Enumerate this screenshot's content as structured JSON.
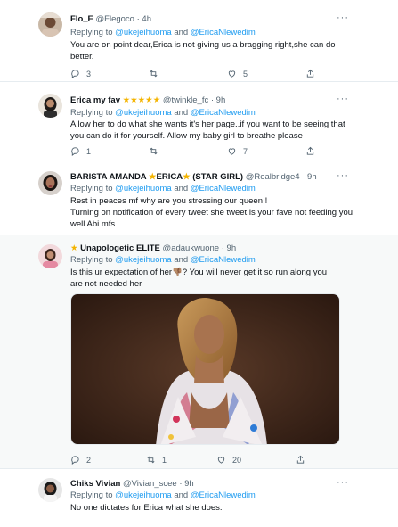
{
  "tweets": [
    {
      "name": "Flo_E",
      "handle": "@Flegoco",
      "time": "4h",
      "reply_prefix": "Replying to",
      "reply_to_1": "@ukejeihuoma",
      "reply_and": "and",
      "reply_to_2": "@EricaNlewedim",
      "text": "You are on point dear,Erica is not giving us a bragging right,she can do better.",
      "replies": "3",
      "likes": "5"
    },
    {
      "name": "Erica my fav",
      "name_stars": "★★★★★",
      "handle": "@twinkle_fc",
      "time": "9h",
      "reply_prefix": "Replying to",
      "reply_to_1": "@ukejeihuoma",
      "reply_and": "and",
      "reply_to_2": "@EricaNlewedim",
      "text": "Allow her to do what she wants it's her page..if you want to be seeing that you can do it for yourself. Allow my baby girl to breathe please",
      "replies": "1",
      "likes": "7"
    },
    {
      "name_part1": "BARISTA AMANDA",
      "star1": "★",
      "name_part2": "ERICA",
      "star2": "★",
      "name_part3": "(STAR GIRL)",
      "handle": "@Realbridge4",
      "time": "9h",
      "reply_prefix": "Replying to",
      "reply_to_1": "@ukejeihuoma",
      "reply_and": "and",
      "reply_to_2": "@EricaNlewedim",
      "text_line1": "Rest in peaces mf why are you stressing our queen !",
      "text_line2": "Turning on notification of every tweet she tweet is your fave not feeding you well Abi mfs"
    },
    {
      "name_star": "★",
      "name": "Unapologetic ELITE",
      "handle": "@adaukwuone",
      "time": "9h",
      "reply_prefix": "Replying to",
      "reply_to_1": "@ukejeihuoma",
      "reply_and": "and",
      "reply_to_2": "@EricaNlewedim",
      "text_a": "Is this ur expectation of her",
      "emoji": "👎🏽",
      "text_b": "? You will never get it so run along you are not needed her",
      "replies": "2",
      "retweets": "1",
      "likes": "20"
    },
    {
      "name": "Chiks Vivian",
      "handle": "@Vivian_scee",
      "time": "9h",
      "reply_prefix": "Replying to",
      "reply_to_1": "@ukejeihuoma",
      "reply_and": "and",
      "reply_to_2": "@EricaNlewedim",
      "text": "No one dictates for Erica what she does."
    }
  ],
  "separator": "·",
  "more_glyph": "···",
  "colors": {
    "link": "#1d9bf0",
    "muted": "#536471",
    "border": "#e6ecf0",
    "star": "#f4b400"
  },
  "icons": [
    "reply-icon",
    "retweet-icon",
    "like-icon",
    "share-icon",
    "more-icon"
  ]
}
